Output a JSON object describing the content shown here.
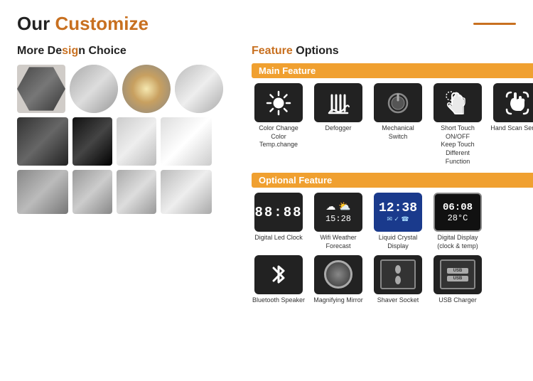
{
  "header": {
    "title_prefix": "Our ",
    "title_highlight": "Customize",
    "accent_line": true
  },
  "left_section": {
    "title_prefix": "More De",
    "title_highlight": "sig",
    "title_suffix": "n Choice",
    "rows": [
      [
        "hexagon",
        "round",
        "round-glow",
        "oval"
      ],
      [
        "rect-dark",
        "rect-black",
        "rect-light",
        "rect-plain"
      ],
      [
        "rect-frame",
        "rect-sq",
        "rect-b",
        "rect-lg"
      ]
    ]
  },
  "right_section": {
    "title_prefix": "",
    "title_highlight": "Feature",
    "title_suffix": " Options",
    "main_feature": {
      "band_label": "Main Feature",
      "items": [
        {
          "id": "color-change",
          "icon": "sun",
          "label": "Color Change\nColor Temp.change"
        },
        {
          "id": "defogger",
          "icon": "defog",
          "label": "Defogger"
        },
        {
          "id": "switch",
          "icon": "switch",
          "label": "Mechanical\nSwitch"
        },
        {
          "id": "touch",
          "icon": "touch",
          "label": "Short Touch ON/OFF\nKeep Touch Different\nFunction"
        },
        {
          "id": "hand-scan",
          "icon": "hand",
          "label": "Hand Scan Sensor"
        }
      ]
    },
    "optional_feature": {
      "band_label": "Optional Feature",
      "row1": [
        {
          "id": "digital-led",
          "icon": "clock",
          "icon_text": "88:88",
          "label": "Digital Led Clock"
        },
        {
          "id": "wifi-weather",
          "icon": "weather",
          "icon_text": "☁ ⛅\n15:28",
          "label": "Wifi Weather Forecast"
        },
        {
          "id": "lcd",
          "icon": "lcd",
          "icon_text": "12:38",
          "label": "Liquid Crystal Display"
        },
        {
          "id": "digital-display",
          "icon": "digital",
          "icon_text": "06:08\n28°C",
          "label": "Digital Display\n(clock & temp)"
        }
      ],
      "row2": [
        {
          "id": "bluetooth",
          "icon": "bluetooth",
          "icon_text": "ᛒ",
          "label": "Bluetooth Speaker"
        },
        {
          "id": "magnifying",
          "icon": "magnify",
          "icon_text": "",
          "label": "Magnifying Mirror"
        },
        {
          "id": "shaver",
          "icon": "shaver",
          "icon_text": "shaver",
          "label": "Shaver Socket"
        },
        {
          "id": "usb",
          "icon": "usb",
          "icon_text": "USB",
          "label": "USB Charger"
        }
      ]
    }
  }
}
